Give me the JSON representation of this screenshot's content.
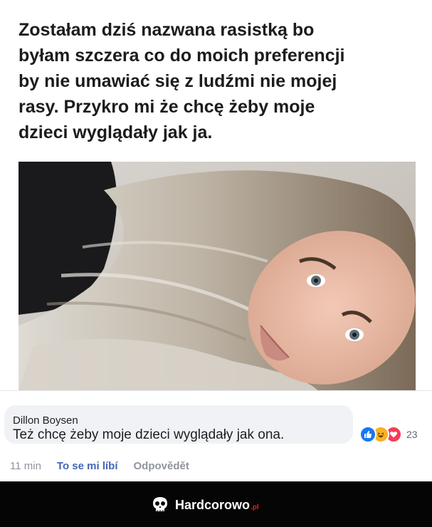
{
  "post": {
    "text": "Zostałam dziś nazwana rasistką bo\nbyłam szczera co do moich preferencji\nby nie umawiać się z ludźmi nie mojej\nrasy. Przykro mi że chcę żeby moje\ndzieci wyglądały jak ja."
  },
  "comment": {
    "author": "Dillon Boysen",
    "text": "Też chcę żeby moje dzieci wyglądały jak ona.",
    "reaction_count": "23",
    "reactions": [
      "like-icon",
      "haha-icon",
      "love-icon"
    ]
  },
  "actions": {
    "time": "11 min",
    "like": "To se mi líbí",
    "reply": "Odpovědět"
  },
  "footer": {
    "brand": "Hardcorowo",
    "tld": ".pl"
  },
  "colors": {
    "like_blue": "#1877f2",
    "haha_yellow": "#f7b125",
    "love_red": "#f33e58",
    "link_blue": "#4267b2",
    "brand_red": "#e41e26"
  }
}
